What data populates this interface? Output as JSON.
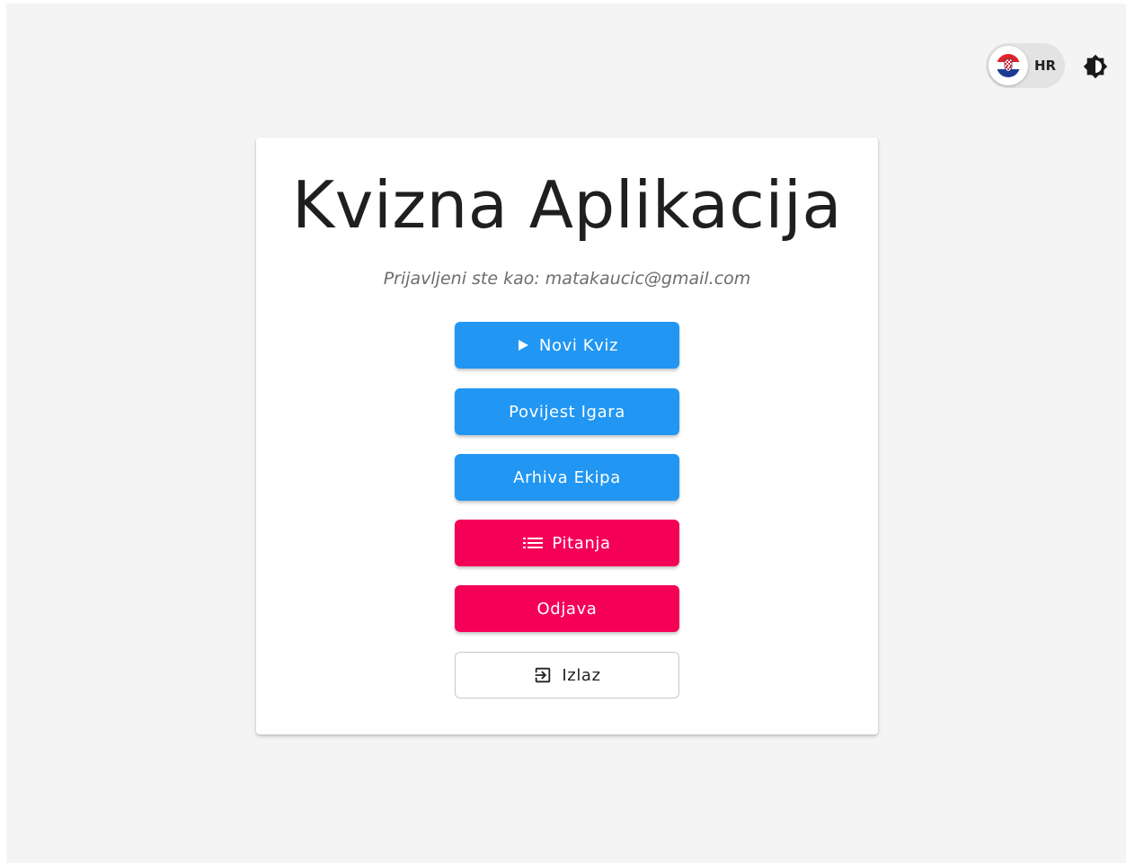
{
  "header": {
    "language": {
      "code": "HR",
      "flag_icon": "croatia-flag-icon"
    },
    "theme_toggle_icon": "brightness-icon"
  },
  "card": {
    "title": "Kvizna Aplikacija",
    "logged_in_text": "Prijavljeni ste kao: matakaucic@gmail.com"
  },
  "buttons": {
    "new_quiz": {
      "label": "Novi Kviz",
      "icon": "play-icon"
    },
    "game_history": {
      "label": "Povijest Igara"
    },
    "team_archive": {
      "label": "Arhiva Ekipa"
    },
    "questions": {
      "label": "Pitanja",
      "icon": "list-icon"
    },
    "logout": {
      "label": "Odjava"
    },
    "exit": {
      "label": "Izlaz",
      "icon": "exit-icon"
    }
  },
  "colors": {
    "primary": "#2196f3",
    "secondary": "#f50057",
    "background": "#f4f4f4"
  }
}
